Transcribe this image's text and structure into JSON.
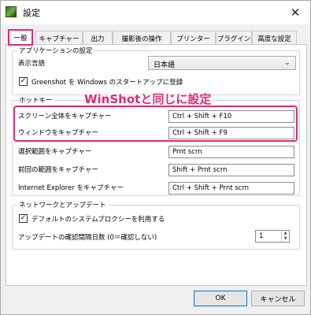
{
  "window": {
    "title": "設定",
    "close_glyph": "✕"
  },
  "tabs": [
    {
      "label": "一般",
      "active": true
    },
    {
      "label": "キャプチャー"
    },
    {
      "label": "出力"
    },
    {
      "label": "撮影後の操作"
    },
    {
      "label": "プリンター"
    },
    {
      "label": "プラグイン"
    },
    {
      "label": "高度な設定"
    }
  ],
  "app_settings": {
    "group_label": "アプリケーションの設定",
    "language_label": "表示言語",
    "language_value": "日本語",
    "startup_label": "Greenshot を Windows のスタートアップに登録",
    "startup_checked": true
  },
  "hotkeys": {
    "group_label": "ホットキー",
    "banner": "WinShotと同じに設定",
    "items": [
      {
        "label": "スクリーン全体をキャプチャー",
        "value": "Ctrl + Shift + F10"
      },
      {
        "label": "ウィンドウをキャプチャー",
        "value": "Ctrl + Shift + F9"
      },
      {
        "label": "選択範囲をキャプチャー",
        "value": "Prnt scrn"
      },
      {
        "label": "前回の範囲をキャプチャー",
        "value": "Shift + Prnt scrn"
      },
      {
        "label": "Internet Explorer をキャプチャー",
        "value": "Ctrl + Shift + Prnt scrn"
      }
    ]
  },
  "network": {
    "group_label": "ネットワークとアップデート",
    "proxy_label": "デフォルトのシステムプロクシーを利用する",
    "proxy_checked": true,
    "interval_label": "アップデートの確認間隔日数 (0＝確認しない)",
    "interval_value": "1"
  },
  "buttons": {
    "ok": "OK",
    "cancel": "キャンセル"
  },
  "colors": {
    "highlight": "#e02a6e",
    "default_button_border": "#0078d7"
  }
}
